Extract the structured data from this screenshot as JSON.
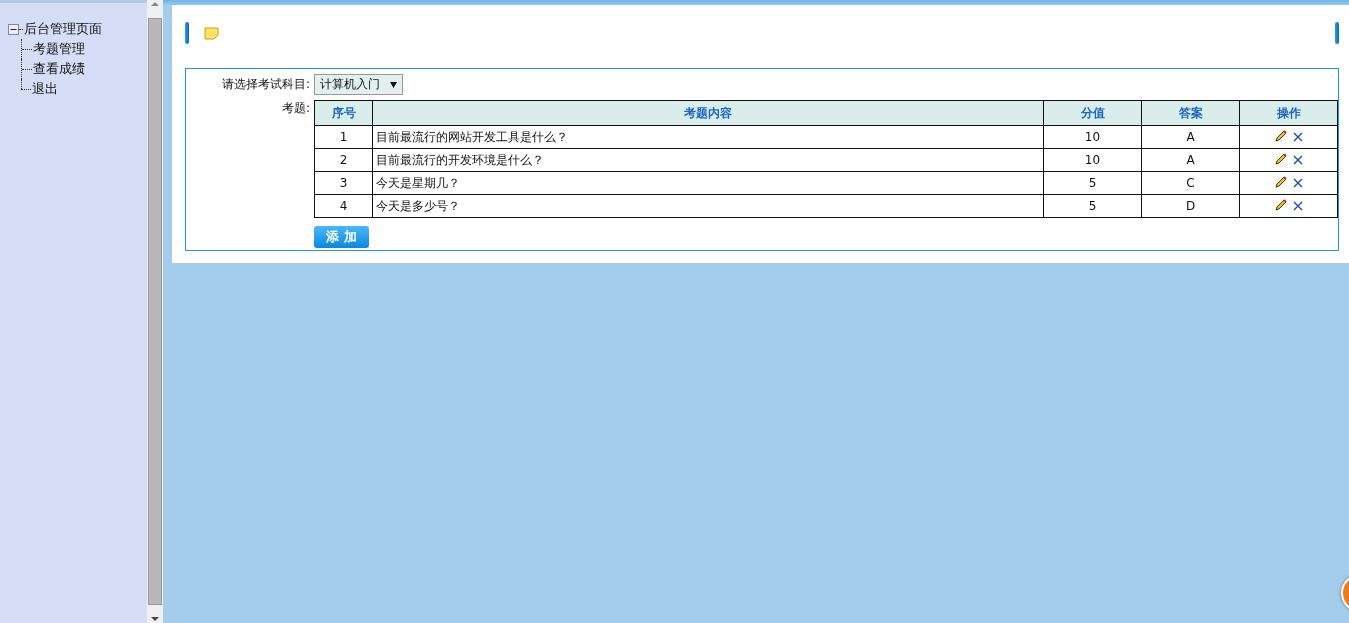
{
  "sidebar": {
    "tree": {
      "label": "后台管理页面",
      "expanded": true,
      "children": [
        {
          "label": "考题管理"
        },
        {
          "label": "查看成绩"
        },
        {
          "label": "退出"
        }
      ]
    }
  },
  "form": {
    "subject_label": "请选择考试科目:",
    "subject_value": "计算机入门",
    "questions_label": "考题:"
  },
  "table": {
    "columns": [
      "序号",
      "考题内容",
      "分值",
      "答案",
      "操作"
    ],
    "rows": [
      {
        "no": "1",
        "content": "目前最流行的网站开发工具是什么？",
        "score": "10",
        "answer": "A"
      },
      {
        "no": "2",
        "content": "目前最流行的开发环境是什么？",
        "score": "10",
        "answer": "A"
      },
      {
        "no": "3",
        "content": "今天是星期几？",
        "score": "5",
        "answer": "C"
      },
      {
        "no": "4",
        "content": "今天是多少号？",
        "score": "5",
        "answer": "D"
      }
    ]
  },
  "add_button": "添 加"
}
